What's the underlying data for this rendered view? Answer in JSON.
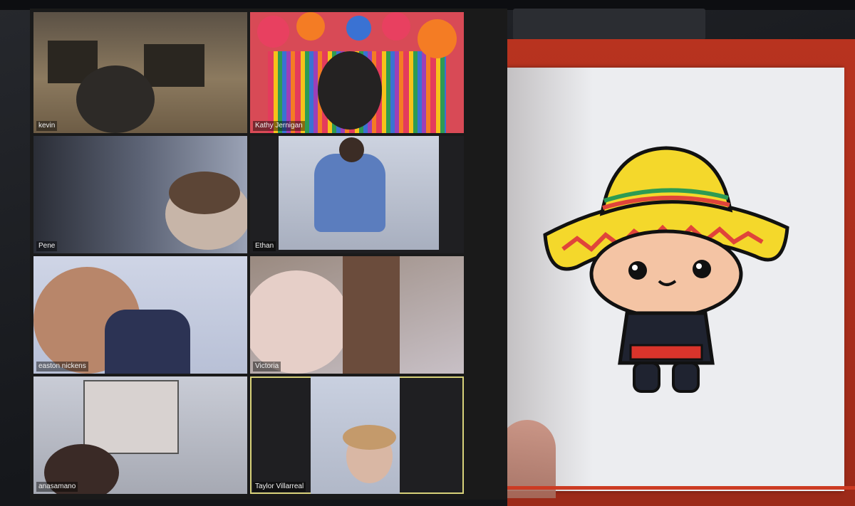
{
  "meeting": {
    "participants": [
      {
        "name": "kevin"
      },
      {
        "name": "Kathy Jernigan"
      },
      {
        "name": "Pene"
      },
      {
        "name": "Ethan"
      },
      {
        "name": "easton nickens"
      },
      {
        "name": "Victoria"
      },
      {
        "name": "anasamano"
      },
      {
        "name": "Taylor Villarreal",
        "active_speaker": true
      }
    ]
  },
  "drawing": {
    "subject": "sombrero-character",
    "colors": {
      "hat": "#f4d82b",
      "hat_band": "#e0443a",
      "accent_green": "#2d9b53",
      "skin": "#f4c4a4",
      "outfit": "#1f2330",
      "sash": "#d9342b"
    }
  },
  "colors": {
    "active_speaker_border": "#d8d27a",
    "background_red": "#b8331f"
  }
}
